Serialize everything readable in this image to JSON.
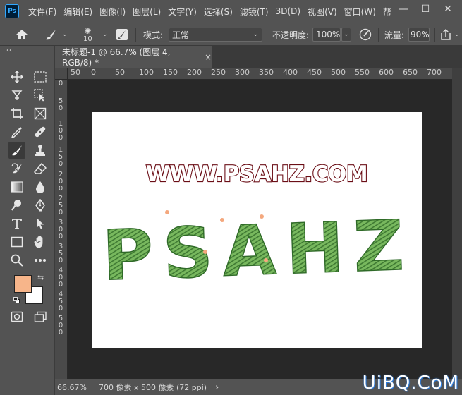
{
  "app": {
    "logo": "Ps"
  },
  "menu": [
    "文件(F)",
    "编辑(E)",
    "图像(I)",
    "图层(L)",
    "文字(Y)",
    "选择(S)",
    "滤镜(T)",
    "3D(D)",
    "视图(V)",
    "窗口(W)",
    "帮"
  ],
  "window_controls": {
    "minimize": "—",
    "maximize": "☐",
    "close": "✕"
  },
  "options": {
    "brush_size": "10",
    "mode_label": "模式:",
    "mode_value": "正常",
    "opacity_label": "不透明度:",
    "opacity_value": "100%",
    "flow_label": "流量:",
    "flow_value": "90%"
  },
  "toolbar": {
    "collapse": "‹‹"
  },
  "tab": {
    "title": "未标题-1 @ 66.7% (图层 4, RGB/8) *",
    "close": "×"
  },
  "ruler": {
    "h_ticks": [
      "50",
      "0",
      "50",
      "100",
      "150",
      "200",
      "250",
      "300",
      "350",
      "400",
      "450",
      "500",
      "550",
      "600",
      "650",
      "700"
    ],
    "v_ticks": [
      "0",
      "5 0",
      "1 0 0",
      "1 5 0",
      "2 0 0",
      "2 5 0",
      "3 0 0",
      "3 5 0",
      "4 0 0",
      "4 5 0",
      "5 0 0"
    ]
  },
  "canvas": {
    "url_text": "WWW.PSAHZ.COM",
    "art_text": "PSAHZ"
  },
  "colors": {
    "foreground": "#f7b58a",
    "background": "#ffffff",
    "accent": "#31a8ff"
  },
  "status": {
    "zoom": "66.67%",
    "doc_info": "700 像素 x 500 像素 (72 ppi)",
    "arrow": "›"
  },
  "watermark": "UiBQ.CoM"
}
